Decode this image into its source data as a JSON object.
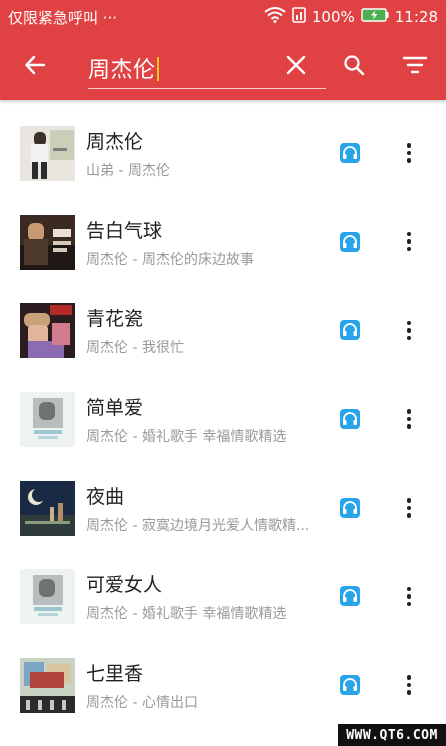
{
  "statusbar": {
    "left_text": "仅限紧急呼叫 ···",
    "battery_percent": "100%",
    "time": "11:28"
  },
  "toolbar": {
    "back_icon": "back-arrow-icon",
    "search_query": "周杰伦",
    "clear_icon": "close-icon",
    "search_icon": "search-icon",
    "filter_icon": "filter-icon"
  },
  "songs": [
    {
      "title": "周杰伦",
      "subtitle": "山弟 - 周杰伦"
    },
    {
      "title": "告白气球",
      "subtitle": "周杰伦 - 周杰伦的床边故事"
    },
    {
      "title": "青花瓷",
      "subtitle": "周杰伦 - 我很忙"
    },
    {
      "title": "简单爱",
      "subtitle": "周杰伦 - 婚礼歌手 幸福情歌精选"
    },
    {
      "title": "夜曲",
      "subtitle": "周杰伦 - 寂寞边境月光爱人情歌精..."
    },
    {
      "title": "可爱女人",
      "subtitle": "周杰伦 - 婚礼歌手 幸福情歌精选"
    },
    {
      "title": "七里香",
      "subtitle": "周杰伦 - 心情出口"
    }
  ],
  "watermark": "WWW.QT6.COM",
  "colors": {
    "primary": "#e04142",
    "hq_badge": "#2aa4e8"
  }
}
